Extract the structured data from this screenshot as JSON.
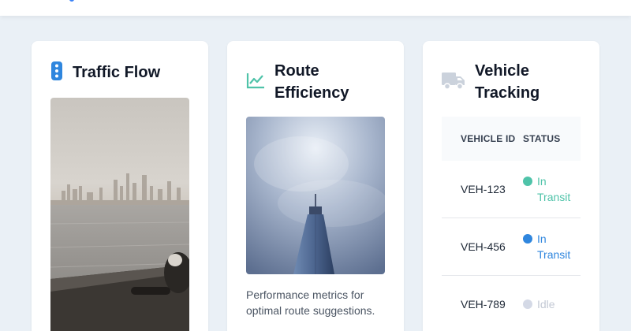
{
  "colors": {
    "page_bg": "#eaf0f6",
    "in_transit_teal": "#4fc3a9",
    "in_transit_blue": "#2f86de",
    "idle_gray": "#d4d9e6",
    "traffic_icon": "#2f86de",
    "route_icon": "#4fc3a9",
    "truck_icon": "#cbd2dc"
  },
  "cards": {
    "traffic": {
      "title": "Traffic Flow",
      "icon": "traffic-light-icon"
    },
    "route": {
      "title": "Route Efficiency",
      "icon": "line-chart-icon",
      "description": "Performance metrics for optimal route suggestions."
    },
    "vehicle": {
      "title": "Vehicle Tracking",
      "icon": "truck-icon",
      "table": {
        "headers": {
          "id": "Vehicle ID",
          "status": "Status"
        },
        "rows": [
          {
            "id": "VEH-123",
            "status": "In Transit",
            "dot_color": "#4fc3a9",
            "text_color": "#4fc3a9"
          },
          {
            "id": "VEH-456",
            "status": "In Transit",
            "dot_color": "#2f86de",
            "text_color": "#2f86de"
          },
          {
            "id": "VEH-789",
            "status": "Idle",
            "dot_color": "#d4d9e6",
            "text_color": "#c3c9d4"
          }
        ]
      }
    }
  }
}
